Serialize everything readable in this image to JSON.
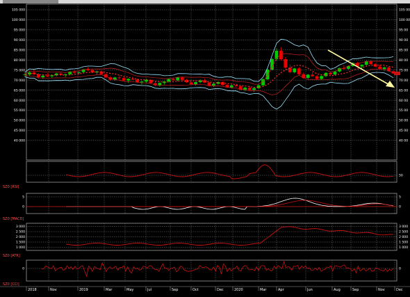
{
  "chart_data": [
    {
      "type": "candlestick",
      "panel": "price",
      "y_ticks": [
        "105 000",
        "100 000",
        "95 000",
        "90 000",
        "85 000",
        "80 000",
        "75 000",
        "70 000",
        "65 000",
        "60 000",
        "55 000",
        "50 000",
        "45 000",
        "40 000"
      ],
      "y_right_ticks": [
        "105 00",
        "100 00",
        "95 00",
        "90 00",
        "85 00",
        "80 00",
        "75 00",
        "70 00",
        "65 00",
        "60 00",
        "55 00",
        "50 00",
        "45 00",
        "40 00"
      ],
      "ylim": [
        37000,
        108000
      ],
      "grid": true,
      "ohlc": [
        [
          72.5,
          73.8,
          71.5,
          72.8
        ],
        [
          72.8,
          74.6,
          72.0,
          73.8
        ],
        [
          73.8,
          75.2,
          72.6,
          72.9
        ],
        [
          72.9,
          73.5,
          70.8,
          71.4
        ],
        [
          71.4,
          72.6,
          70.5,
          72.2
        ],
        [
          72.2,
          73.4,
          71.4,
          71.9
        ],
        [
          71.9,
          72.8,
          70.9,
          72.4
        ],
        [
          72.4,
          73.6,
          71.8,
          73.3
        ],
        [
          73.3,
          74.0,
          72.3,
          72.6
        ],
        [
          72.6,
          73.2,
          71.5,
          72.9
        ],
        [
          72.9,
          74.4,
          72.6,
          74.1
        ],
        [
          74.1,
          75.0,
          73.2,
          73.6
        ],
        [
          73.6,
          74.2,
          72.8,
          74.0
        ],
        [
          74.0,
          75.6,
          73.6,
          75.3
        ],
        [
          75.3,
          76.4,
          74.4,
          74.9
        ],
        [
          74.9,
          75.5,
          73.5,
          73.8
        ],
        [
          73.8,
          74.6,
          72.9,
          74.3
        ],
        [
          74.3,
          74.9,
          72.6,
          72.9
        ],
        [
          72.9,
          73.3,
          70.9,
          71.4
        ],
        [
          71.4,
          72.0,
          69.7,
          70.2
        ],
        [
          70.2,
          71.6,
          69.6,
          71.3
        ],
        [
          71.3,
          72.4,
          70.3,
          71.0
        ],
        [
          71.0,
          71.5,
          69.5,
          69.8
        ],
        [
          69.8,
          70.9,
          68.6,
          70.6
        ],
        [
          70.6,
          71.7,
          69.8,
          70.3
        ],
        [
          70.3,
          70.8,
          68.5,
          68.9
        ],
        [
          68.9,
          69.6,
          67.7,
          69.3
        ],
        [
          69.3,
          70.6,
          68.6,
          70.1
        ],
        [
          70.1,
          70.5,
          68.3,
          68.5
        ],
        [
          68.5,
          69.1,
          66.9,
          67.4
        ],
        [
          67.4,
          68.9,
          66.7,
          68.6
        ],
        [
          68.6,
          69.6,
          67.8,
          69.3
        ],
        [
          69.3,
          70.9,
          68.8,
          70.5
        ],
        [
          70.5,
          71.4,
          69.6,
          69.9
        ],
        [
          69.9,
          71.6,
          69.4,
          71.3
        ],
        [
          71.3,
          71.8,
          69.7,
          70.1
        ],
        [
          70.1,
          70.7,
          68.6,
          68.9
        ],
        [
          68.9,
          69.4,
          67.6,
          67.9
        ],
        [
          67.9,
          69.3,
          67.3,
          69.0
        ],
        [
          69.0,
          70.3,
          68.4,
          69.8
        ],
        [
          69.8,
          70.6,
          68.5,
          68.8
        ],
        [
          68.8,
          69.2,
          66.9,
          67.3
        ],
        [
          67.3,
          68.6,
          66.5,
          68.2
        ],
        [
          68.2,
          69.5,
          67.6,
          69.0
        ],
        [
          69.0,
          69.4,
          67.3,
          67.6
        ],
        [
          67.6,
          68.1,
          66.1,
          66.4
        ],
        [
          66.4,
          67.8,
          65.8,
          67.4
        ],
        [
          67.4,
          68.3,
          66.5,
          66.9
        ],
        [
          66.9,
          67.4,
          65.0,
          65.3
        ],
        [
          65.3,
          66.6,
          64.6,
          66.2
        ],
        [
          66.2,
          67.1,
          64.9,
          65.1
        ],
        [
          65.1,
          66.4,
          64.1,
          66.0
        ],
        [
          66.0,
          67.8,
          65.6,
          67.4
        ],
        [
          67.4,
          70.8,
          67.1,
          70.4
        ],
        [
          70.4,
          75.6,
          70.0,
          75.2
        ],
        [
          75.2,
          81.0,
          74.8,
          80.5
        ],
        [
          80.5,
          85.8,
          79.6,
          84.6
        ],
        [
          84.6,
          86.4,
          79.8,
          80.4
        ],
        [
          80.4,
          81.5,
          75.6,
          76.2
        ],
        [
          76.2,
          77.8,
          73.4,
          73.9
        ],
        [
          73.9,
          76.1,
          73.4,
          75.8
        ],
        [
          75.8,
          76.4,
          72.5,
          72.9
        ],
        [
          72.9,
          73.7,
          70.6,
          71.1
        ],
        [
          71.1,
          73.1,
          70.4,
          72.7
        ],
        [
          72.7,
          73.9,
          71.6,
          71.9
        ],
        [
          71.9,
          72.6,
          70.1,
          70.6
        ],
        [
          70.6,
          72.3,
          70.2,
          72.0
        ],
        [
          72.0,
          73.9,
          71.5,
          73.6
        ],
        [
          73.6,
          74.3,
          72.4,
          72.8
        ],
        [
          72.8,
          74.6,
          72.4,
          74.3
        ],
        [
          74.3,
          76.2,
          73.9,
          75.9
        ],
        [
          75.9,
          77.4,
          75.2,
          75.6
        ],
        [
          75.6,
          77.3,
          75.1,
          77.0
        ],
        [
          77.0,
          78.9,
          76.6,
          78.5
        ],
        [
          78.5,
          79.1,
          76.4,
          76.8
        ],
        [
          76.8,
          77.9,
          75.6,
          77.6
        ],
        [
          77.6,
          79.8,
          77.2,
          79.4
        ],
        [
          79.4,
          80.1,
          77.6,
          77.9
        ],
        [
          77.9,
          78.5,
          76.4,
          76.7
        ],
        [
          76.7,
          77.6,
          75.3,
          75.6
        ],
        [
          75.6,
          76.8,
          74.5,
          76.3
        ],
        [
          76.3,
          76.9,
          74.1,
          74.4
        ],
        [
          74.4,
          75.0,
          73.0,
          73.3
        ]
      ]
    },
    {
      "type": "line",
      "panel": "rsi",
      "name": "SZ0 [RSI]",
      "y_ticks": [
        "50"
      ]
    },
    {
      "type": "line",
      "panel": "macd",
      "name": "SZ0 [MACD]",
      "y_ticks": [
        "5",
        "0",
        "-5"
      ]
    },
    {
      "type": "line",
      "panel": "atr",
      "name": "SZ0 [ATR]",
      "y_ticks": [
        "3 000",
        "2 500",
        "2 000",
        "1 500",
        "1 000"
      ],
      "y_right_ticks": [
        "3 000",
        "2 500",
        "2 000",
        "1 500",
        "1 000"
      ]
    },
    {
      "type": "line",
      "panel": "cci",
      "name": "SZ0 [CCI]",
      "y_ticks": [
        "0"
      ]
    }
  ],
  "x_axis": {
    "labels": [
      "2018",
      "Nov",
      "2019",
      "Mar",
      "May",
      "Jul",
      "Sep",
      "Oct",
      "Dec",
      "2020",
      "Mar",
      "Apr",
      "Jun",
      "Aug",
      "Sep",
      "Nov",
      "Dec"
    ]
  },
  "colors": {
    "bull": "#00cc00",
    "bear": "#ee0000",
    "grid": "#7a7a7a",
    "indicator": "#cc1111",
    "band": "#9be3ff",
    "arrow": "#fff8a0"
  }
}
